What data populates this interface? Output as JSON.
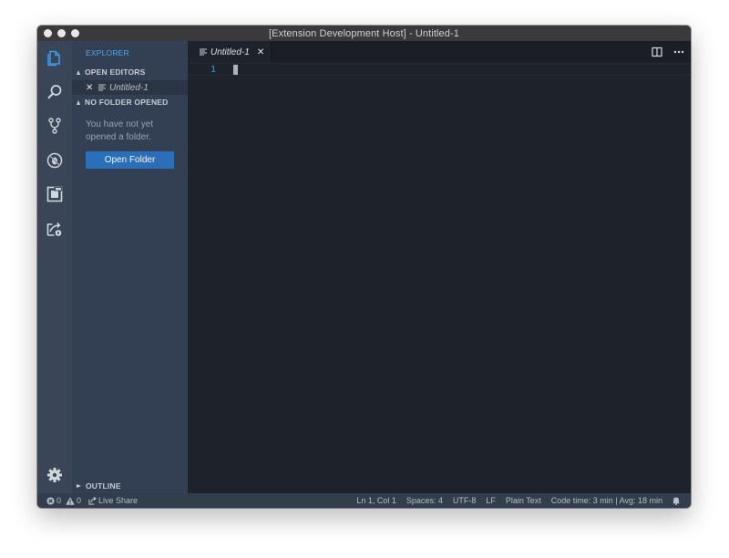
{
  "window": {
    "title": "[Extension Development Host] - Untitled-1"
  },
  "activity_bar": {
    "items": [
      {
        "name": "explorer",
        "icon": "files-icon",
        "active": true
      },
      {
        "name": "search",
        "icon": "search-icon"
      },
      {
        "name": "source-control",
        "icon": "source-control-icon"
      },
      {
        "name": "debug",
        "icon": "debug-icon"
      },
      {
        "name": "extensions",
        "icon": "extensions-icon"
      },
      {
        "name": "live-share",
        "icon": "live-share-icon"
      }
    ],
    "settings_icon": "gear-icon"
  },
  "sidebar": {
    "title": "EXPLORER",
    "open_editors": {
      "header": "OPEN EDITORS",
      "items": [
        {
          "label": "Untitled-1",
          "close": "✕"
        }
      ]
    },
    "no_folder": {
      "header": "NO FOLDER OPENED",
      "message": "You have not yet opened a folder.",
      "button": "Open Folder"
    },
    "outline": {
      "header": "OUTLINE"
    }
  },
  "editor": {
    "tabs": [
      {
        "label": "Untitled-1",
        "close": "✕",
        "active": true
      }
    ],
    "lines": [
      "1"
    ]
  },
  "statusbar": {
    "errors": "0",
    "warnings": "0",
    "live_share": "Live Share",
    "position": "Ln 1, Col 1",
    "spaces": "Spaces: 4",
    "encoding": "UTF-8",
    "eol": "LF",
    "language": "Plain Text",
    "code_time": "Code time: 3 min | Avg: 18 min"
  },
  "colors": {
    "accent": "#59a8e8",
    "button": "#2b6fb8",
    "activity_bar": "#3a4557",
    "sidebar": "#333f52",
    "editor": "#1e222a"
  }
}
